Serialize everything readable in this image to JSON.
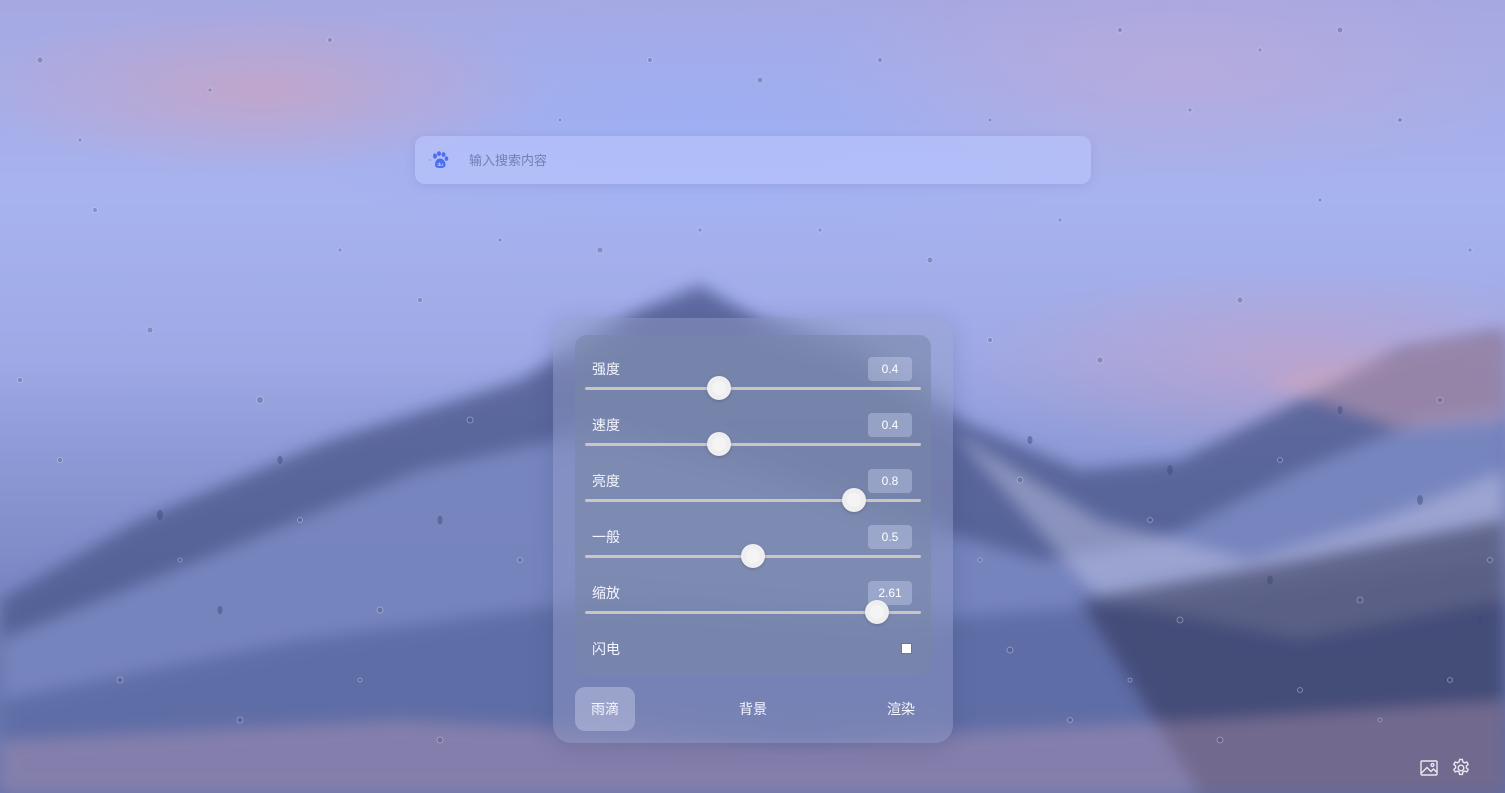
{
  "search": {
    "placeholder": "输入搜索内容",
    "engine_icon": "baidu-paw-icon"
  },
  "panel": {
    "sliders": [
      {
        "label": "强度",
        "value": "0.4",
        "fraction": 0.4
      },
      {
        "label": "速度",
        "value": "0.4",
        "fraction": 0.4
      },
      {
        "label": "亮度",
        "value": "0.8",
        "fraction": 0.8
      },
      {
        "label": "一般",
        "value": "0.5",
        "fraction": 0.5
      },
      {
        "label": "缩放",
        "value": "2.61",
        "fraction": 0.87
      }
    ],
    "toggle": {
      "label": "闪电",
      "checked": false
    },
    "tabs": [
      {
        "label": "雨滴",
        "active": true
      },
      {
        "label": "背景",
        "active": false
      },
      {
        "label": "渲染",
        "active": false
      }
    ]
  },
  "corner_icons": [
    "image-icon",
    "gear-icon"
  ],
  "colors": {
    "accent": "#4e6ef2",
    "panel_text": "#f3f5ff"
  }
}
